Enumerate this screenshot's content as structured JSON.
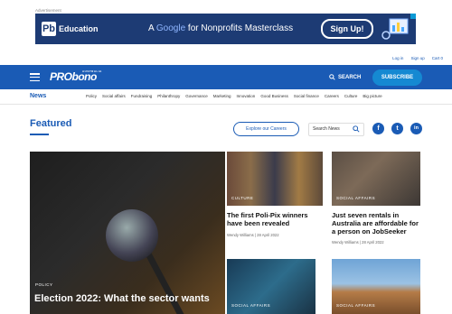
{
  "ad": {
    "label": "Advertisement",
    "logo_letters": "Pb",
    "brand": "Education",
    "message_pre": "A ",
    "message_google": "Google",
    "message_post": " for Nonprofits Masterclass",
    "cta": "Sign Up!"
  },
  "utility": {
    "login": "Log in",
    "signup": "Sign up",
    "cart": "Cart",
    "cart_count": "0"
  },
  "header": {
    "logo_main": "PRObono",
    "logo_small": "AUSTRALIA",
    "search_label": "SEARCH",
    "subscribe_label": "SUBSCRIBE"
  },
  "nav": {
    "brand": "News",
    "items": [
      "Policy",
      "Social affairs",
      "Fundraising",
      "Philanthropy",
      "Governance",
      "Marketing",
      "Innovation",
      "Good Business",
      "Social finance",
      "Careers",
      "Culture",
      "Big picture"
    ]
  },
  "featured": {
    "title": "Featured",
    "careers_button": "Explore our Careers",
    "search_placeholder": "Search News",
    "social": {
      "facebook": "f",
      "twitter": "t",
      "linkedin": "in"
    }
  },
  "articles": [
    {
      "category": "POLICY",
      "title": "Election 2022: What the sector wants",
      "meta": ""
    },
    {
      "category": "CULTURE",
      "title": "The first Poli-Pix winners have been revealed",
      "meta": "Wendy Williams | 28 April 2022"
    },
    {
      "category": "SOCIAL AFFAIRS",
      "title": "Just seven rentals in Australia are affordable for a person on JobSeeker",
      "meta": "Wendy Williams | 28 April 2022"
    },
    {
      "category": "SOCIAL AFFAIRS",
      "title": "",
      "meta": ""
    },
    {
      "category": "SOCIAL AFFAIRS",
      "title": "",
      "meta": ""
    }
  ]
}
